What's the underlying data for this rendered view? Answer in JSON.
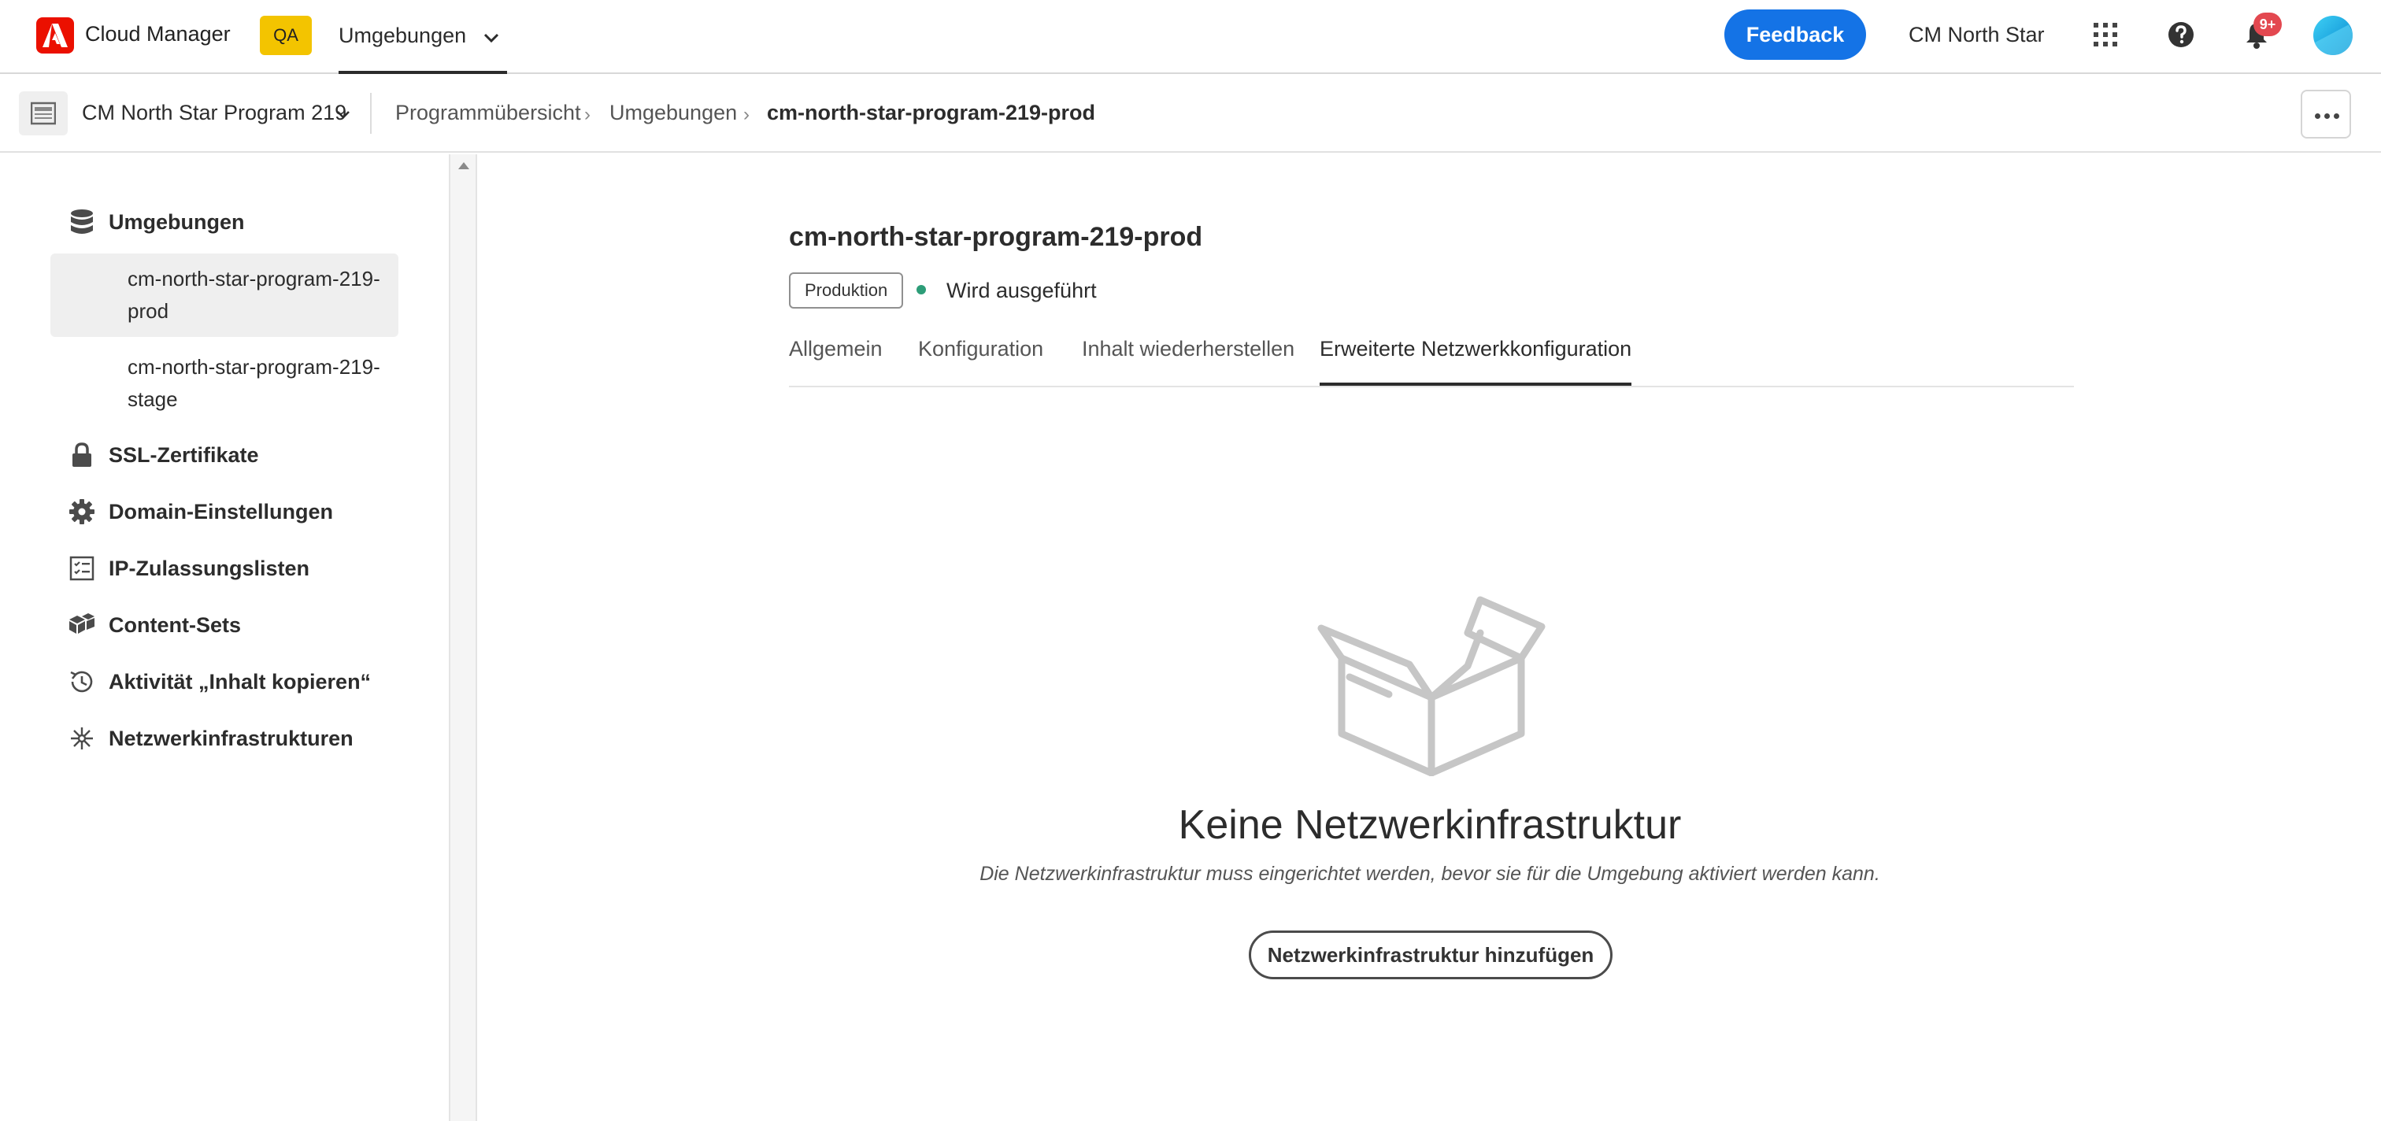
{
  "topbar": {
    "app_name": "Cloud Manager",
    "env_badge": "QA",
    "nav_label": "Umgebungen",
    "feedback_label": "Feedback",
    "user_name": "CM North Star",
    "notification_count": "9+",
    "icons": [
      "adobe-logo-icon",
      "apps-grid-icon",
      "help-icon",
      "bell-icon",
      "avatar"
    ]
  },
  "subbar": {
    "program_name": "CM North Star Program 219",
    "breadcrumb": {
      "item1": "Programmübersicht",
      "item2": "Umgebungen",
      "current": "cm-north-star-program-219-prod"
    },
    "separator": "›"
  },
  "sidebar": {
    "environments_label": "Umgebungen",
    "env_items": [
      {
        "label": "cm-north-star-program-219-prod",
        "selected": true
      },
      {
        "label": "cm-north-star-program-219-stage",
        "selected": false
      }
    ],
    "items": [
      {
        "label": "SSL-Zertifikate",
        "icon": "lock-icon"
      },
      {
        "label": "Domain-Einstellungen",
        "icon": "gear-icon"
      },
      {
        "label": "IP-Zulassungslisten",
        "icon": "checklist-icon"
      },
      {
        "label": "Content-Sets",
        "icon": "boxes-icon"
      },
      {
        "label": "Aktivität „Inhalt kopieren“",
        "icon": "history-icon"
      },
      {
        "label": "Netzwerkinfrastrukturen",
        "icon": "network-icon"
      }
    ]
  },
  "main": {
    "env_title": "cm-north-star-program-219-prod",
    "tag": "Produktion",
    "status": "Wird ausgeführt",
    "status_color": "#2d9d78",
    "tabs": [
      {
        "label": "Allgemein",
        "active": false
      },
      {
        "label": "Konfiguration",
        "active": false
      },
      {
        "label": "Inhalt wiederherstellen",
        "active": false
      },
      {
        "label": "Erweiterte Netzwerkkonfiguration",
        "active": true
      }
    ],
    "empty_state": {
      "title": "Keine Netzwerkinfrastruktur",
      "description": "Die Netzwerkinfrastruktur muss eingerichtet werden, bevor sie für die Umgebung aktiviert werden kann.",
      "button": "Netzwerkinfrastruktur hinzufügen",
      "icon": "empty-box-icon"
    }
  },
  "colors": {
    "accent": "#1473e6",
    "adobe_red": "#eb1000",
    "qa_badge": "#f3c400",
    "notification": "#e34850"
  }
}
